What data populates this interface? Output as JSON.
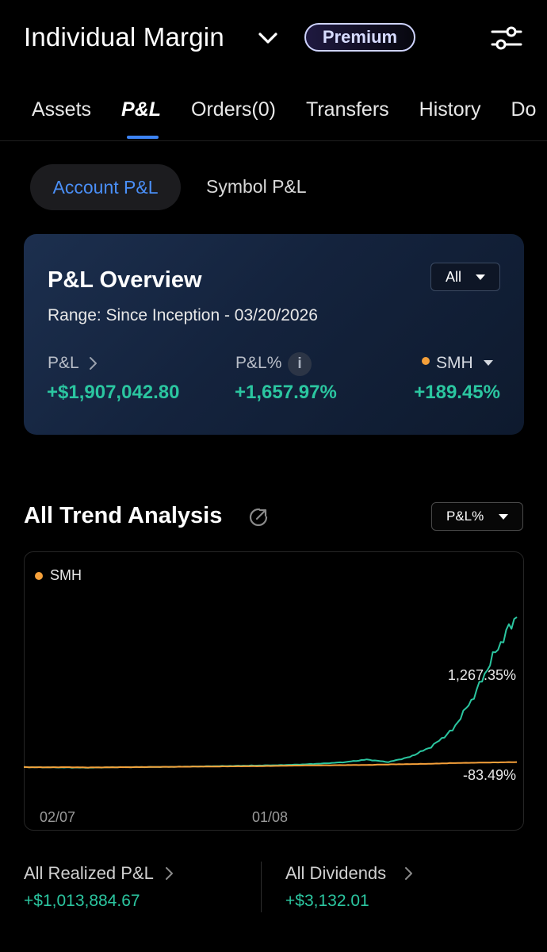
{
  "header": {
    "account_title": "Individual Margin",
    "badge": "Premium",
    "icons": {
      "dropdown": "chevron-down-icon",
      "filter": "sliders-icon"
    }
  },
  "tabs": [
    {
      "label": "Assets",
      "active": false
    },
    {
      "label": "P&L",
      "active": true
    },
    {
      "label": "Orders(0)",
      "active": false
    },
    {
      "label": "Transfers",
      "active": false
    },
    {
      "label": "History",
      "active": false
    },
    {
      "label": "Do",
      "active": false
    }
  ],
  "subtabs": {
    "active": "Account P&L",
    "inactive": "Symbol P&L"
  },
  "overview": {
    "title": "P&L Overview",
    "range_filter": "All",
    "range_text": "Range: Since Inception - 03/20/2026",
    "pl_label": "P&L",
    "pl_value": "+$1,907,042.80",
    "plpct_label": "P&L%",
    "info_icon": "i",
    "plpct_value": "+1,657.97%",
    "benchmark_label": "SMH",
    "benchmark_value": "+189.45%"
  },
  "trend": {
    "title": "All Trend Analysis",
    "metric_filter": "P&L%",
    "legend_benchmark": "SMH",
    "account_end_label": "1,267.35%",
    "benchmark_end_label": "-83.49%",
    "x_labels": [
      "02/07",
      "01/08"
    ]
  },
  "chart_data": {
    "type": "line",
    "x_tick_labels": [
      "02/07",
      "01/08"
    ],
    "series": [
      {
        "name": "SMH",
        "color": "#f5a03a",
        "values": [
          0,
          -1,
          0,
          -2,
          -1,
          0,
          1,
          2,
          3,
          4,
          5,
          6,
          8,
          10,
          11,
          12,
          13,
          16,
          18,
          20,
          24,
          26,
          28,
          30
        ]
      },
      {
        "color": "#2bc6a0",
        "values": [
          0,
          -1,
          -2,
          -3,
          -1,
          0,
          1,
          2,
          4,
          6,
          8,
          10,
          12,
          16,
          22,
          30,
          45,
          30,
          60,
          120,
          220,
          420,
          680,
          900
        ]
      }
    ],
    "end_labels": [
      "1,267.35%",
      "-83.49%"
    ],
    "grid": false
  },
  "bottom": {
    "realized_label": "All Realized P&L",
    "realized_value": "+$1,013,884.67",
    "dividends_label": "All Dividends",
    "dividends_value": "+$3,132.01"
  },
  "colors": {
    "positive": "#2bc6a0",
    "accent_blue": "#3d84f5",
    "benchmark_orange": "#f5a03a",
    "background": "#000000"
  }
}
